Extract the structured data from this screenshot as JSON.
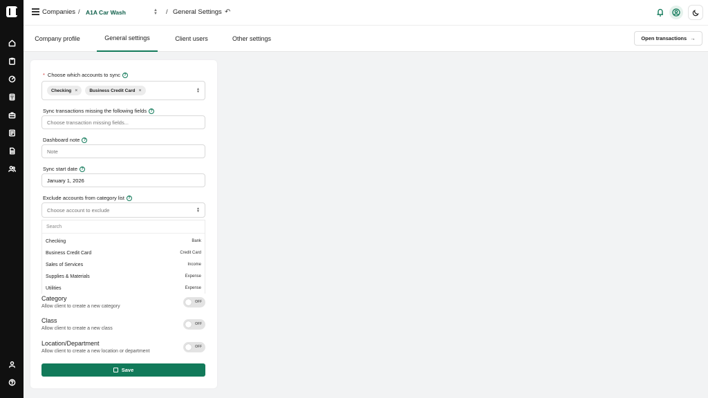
{
  "breadcrumb": {
    "root": "Companies",
    "sep1": "/",
    "company": "A1A Car Wash",
    "sep2": "/",
    "page": "General Settings"
  },
  "tabs": [
    {
      "label": "Company profile"
    },
    {
      "label": "General settings",
      "active": true
    },
    {
      "label": "Client users"
    },
    {
      "label": "Other settings"
    }
  ],
  "open_transactions": {
    "label": "Open transactions",
    "icon": "arrow-right-icon"
  },
  "form": {
    "sync_accounts": {
      "required_mark": "*",
      "label": "Choose which accounts to sync",
      "chips": [
        "Checking",
        "Business Credit Card"
      ],
      "chip_remove": "×"
    },
    "missing_fields": {
      "label": "Sync transactions missing the following fields",
      "placeholder": "Choose transaction missing fields..."
    },
    "dashboard_note": {
      "label": "Dashboard note",
      "placeholder": "Note"
    },
    "sync_start": {
      "label": "Sync start date",
      "value": "January 1, 2026"
    },
    "exclude": {
      "label": "Exclude accounts from category list",
      "placeholder": "Choose account to exclude"
    },
    "dropdown": {
      "search_placeholder": "Search",
      "options": [
        {
          "name": "Checking",
          "type": "Bank"
        },
        {
          "name": "Business Credit Card",
          "type": "Credit Card"
        },
        {
          "name": "Sales of Services",
          "type": "Income"
        },
        {
          "name": "Supplies & Materials",
          "type": "Expense"
        },
        {
          "name": "Utilities",
          "type": "Expense"
        }
      ]
    },
    "toggles": [
      {
        "title": "Category",
        "desc": "Allow client to create a new category",
        "state": "OFF"
      },
      {
        "title": "Class",
        "desc": "Allow client to create a new class",
        "state": "OFF"
      },
      {
        "title": "Location/Department",
        "desc": "Allow client to create a new location or department",
        "state": "OFF"
      }
    ],
    "save_label": "Save"
  },
  "colors": {
    "accent": "#127a5a",
    "sidebar": "#101010",
    "required": "#d23a3a"
  }
}
